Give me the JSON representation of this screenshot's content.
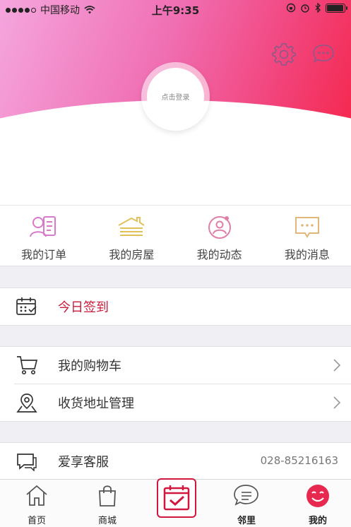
{
  "status_bar": {
    "carrier": "中国移动",
    "time": "上午9:35",
    "battery_level": 0.95
  },
  "header": {
    "avatar_text": "点击登录",
    "settings_icon": "gear-icon",
    "message_icon": "chat-bubble-icon"
  },
  "quick_actions": [
    {
      "label": "我的订单",
      "icon": "order-icon",
      "color": "#d879c9"
    },
    {
      "label": "我的房屋",
      "icon": "house-icon",
      "color": "#e3c15a"
    },
    {
      "label": "我的动态",
      "icon": "moment-icon",
      "color": "#e07fa8"
    },
    {
      "label": "我的消息",
      "icon": "message-icon",
      "color": "#e3b77a"
    }
  ],
  "menu": {
    "checkin": {
      "label": "今日签到",
      "color": "#c81c3a"
    },
    "cart": {
      "label": "我的购物车"
    },
    "address": {
      "label": "收货地址管理"
    },
    "service": {
      "label": "爱享客服",
      "phone": "028-85216163"
    }
  },
  "tabs": [
    {
      "label": "首页",
      "icon": "home-icon"
    },
    {
      "label": "商城",
      "icon": "shopping-bag-icon"
    },
    {
      "label": "",
      "icon": "calendar-check-icon"
    },
    {
      "label": "邻里",
      "icon": "neighbor-chat-icon"
    },
    {
      "label": "我的",
      "icon": "smiley-icon",
      "active_color": "#e8294f"
    }
  ]
}
